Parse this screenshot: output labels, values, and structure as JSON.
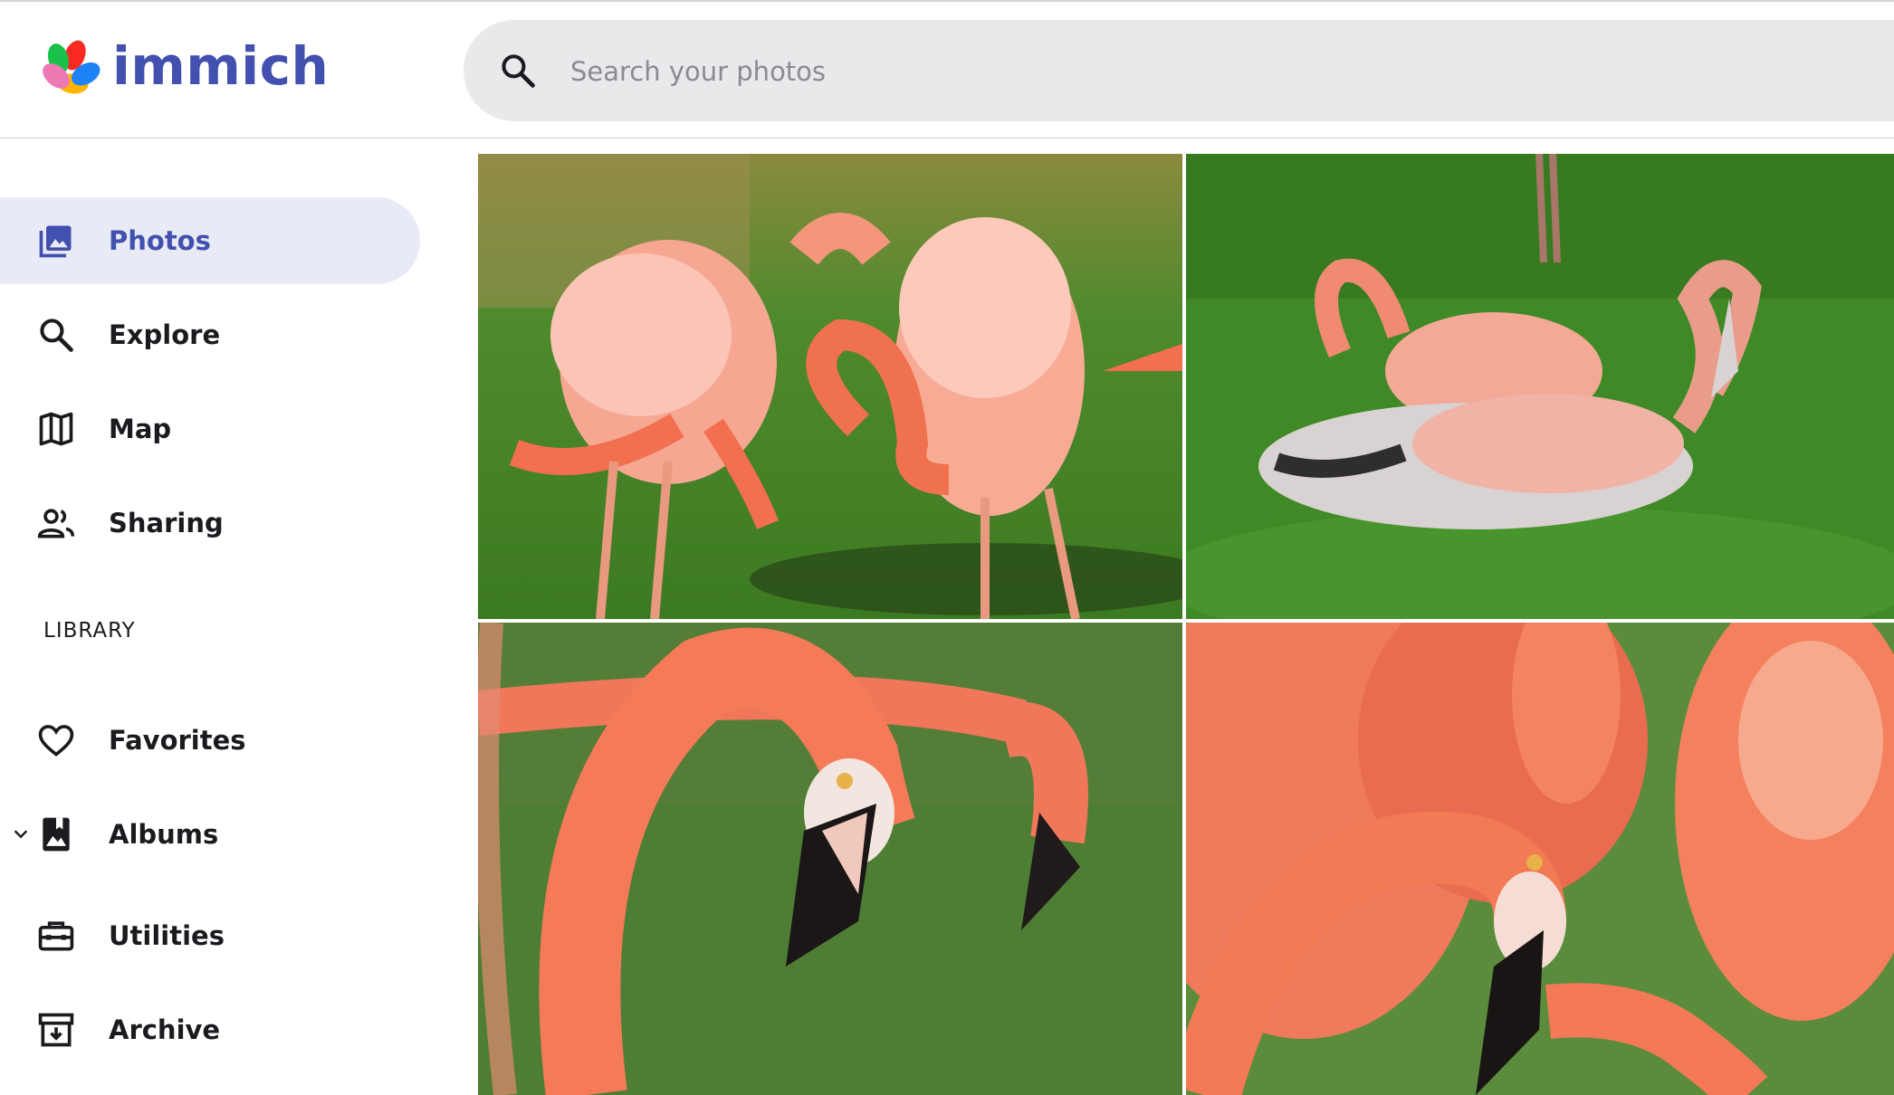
{
  "app": {
    "name": "immich"
  },
  "icons": {
    "logo": "immich-pinwheel-icon",
    "search": "search-icon",
    "photos": "photos-icon",
    "explore": "explore-search-icon",
    "map": "map-icon",
    "sharing": "sharing-people-icon",
    "favorites": "heart-icon",
    "albums": "album-icon",
    "utilities": "toolbox-icon",
    "archive": "archive-icon",
    "expand": "chevron-down-icon"
  },
  "colors": {
    "brand": "#4250af",
    "active_bg": "#e8eaf6",
    "search_bg": "#e9e9ec"
  },
  "search": {
    "placeholder": "Search your photos"
  },
  "sidebar": {
    "items": [
      {
        "label": "Photos",
        "active": true
      },
      {
        "label": "Explore"
      },
      {
        "label": "Map"
      },
      {
        "label": "Sharing"
      }
    ],
    "library_title": "LIBRARY",
    "library_items": [
      {
        "label": "Favorites"
      },
      {
        "label": "Albums"
      },
      {
        "label": "Utilities"
      },
      {
        "label": "Archive"
      }
    ]
  },
  "gallery": {
    "photos": [
      {
        "subject": "flamingo-photo-1"
      },
      {
        "subject": "flamingo-photo-2"
      },
      {
        "subject": "flamingo-photo-3"
      },
      {
        "subject": "flamingo-photo-4"
      }
    ]
  }
}
